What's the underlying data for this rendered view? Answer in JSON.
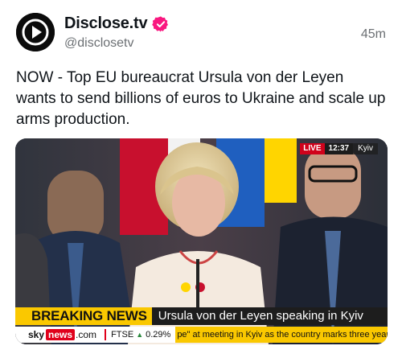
{
  "account": {
    "display_name": "Disclose.tv",
    "handle": "@disclosetv",
    "time": "45m",
    "avatar_icon": "play-logo-icon",
    "verified_icon": "verified-badge-icon",
    "verified_color": "#f91880"
  },
  "tweet": {
    "text": "NOW - Top EU bureaucrat Ursula von der Leyen wants to send billions of euros to Ukraine and scale up arms production."
  },
  "broadcast": {
    "live": "LIVE",
    "clock": "12:37",
    "location": "Kyiv",
    "breaking_label": "BREAKING NEWS",
    "headline": "Ursula von der Leyen speaking in Kyiv",
    "sky": "sky",
    "news": "news",
    "dotcom": ".com",
    "ftse_label": "FTSE",
    "ftse_change": "0.29%",
    "ticker": "pe\" at meeting in Kyiv as the country marks three years of war with Rus"
  },
  "colors": {
    "breaking_yellow": "#fac800",
    "sky_red": "#e0001b",
    "live_red": "#d0021b"
  }
}
